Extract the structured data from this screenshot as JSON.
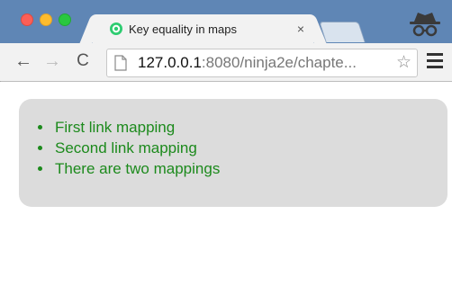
{
  "browser": {
    "tab": {
      "title": "Key equality in maps",
      "close": "×",
      "favicon": "green-circle-icon"
    },
    "address": {
      "host": "127.0.0.1",
      "rest": ":8080/ninja2e/chapte..."
    },
    "icons": {
      "back": "←",
      "forward": "→",
      "reload": "C",
      "star": "☆"
    }
  },
  "page": {
    "results": [
      "First link mapping",
      "Second link mapping",
      "There are two mappings"
    ]
  }
}
